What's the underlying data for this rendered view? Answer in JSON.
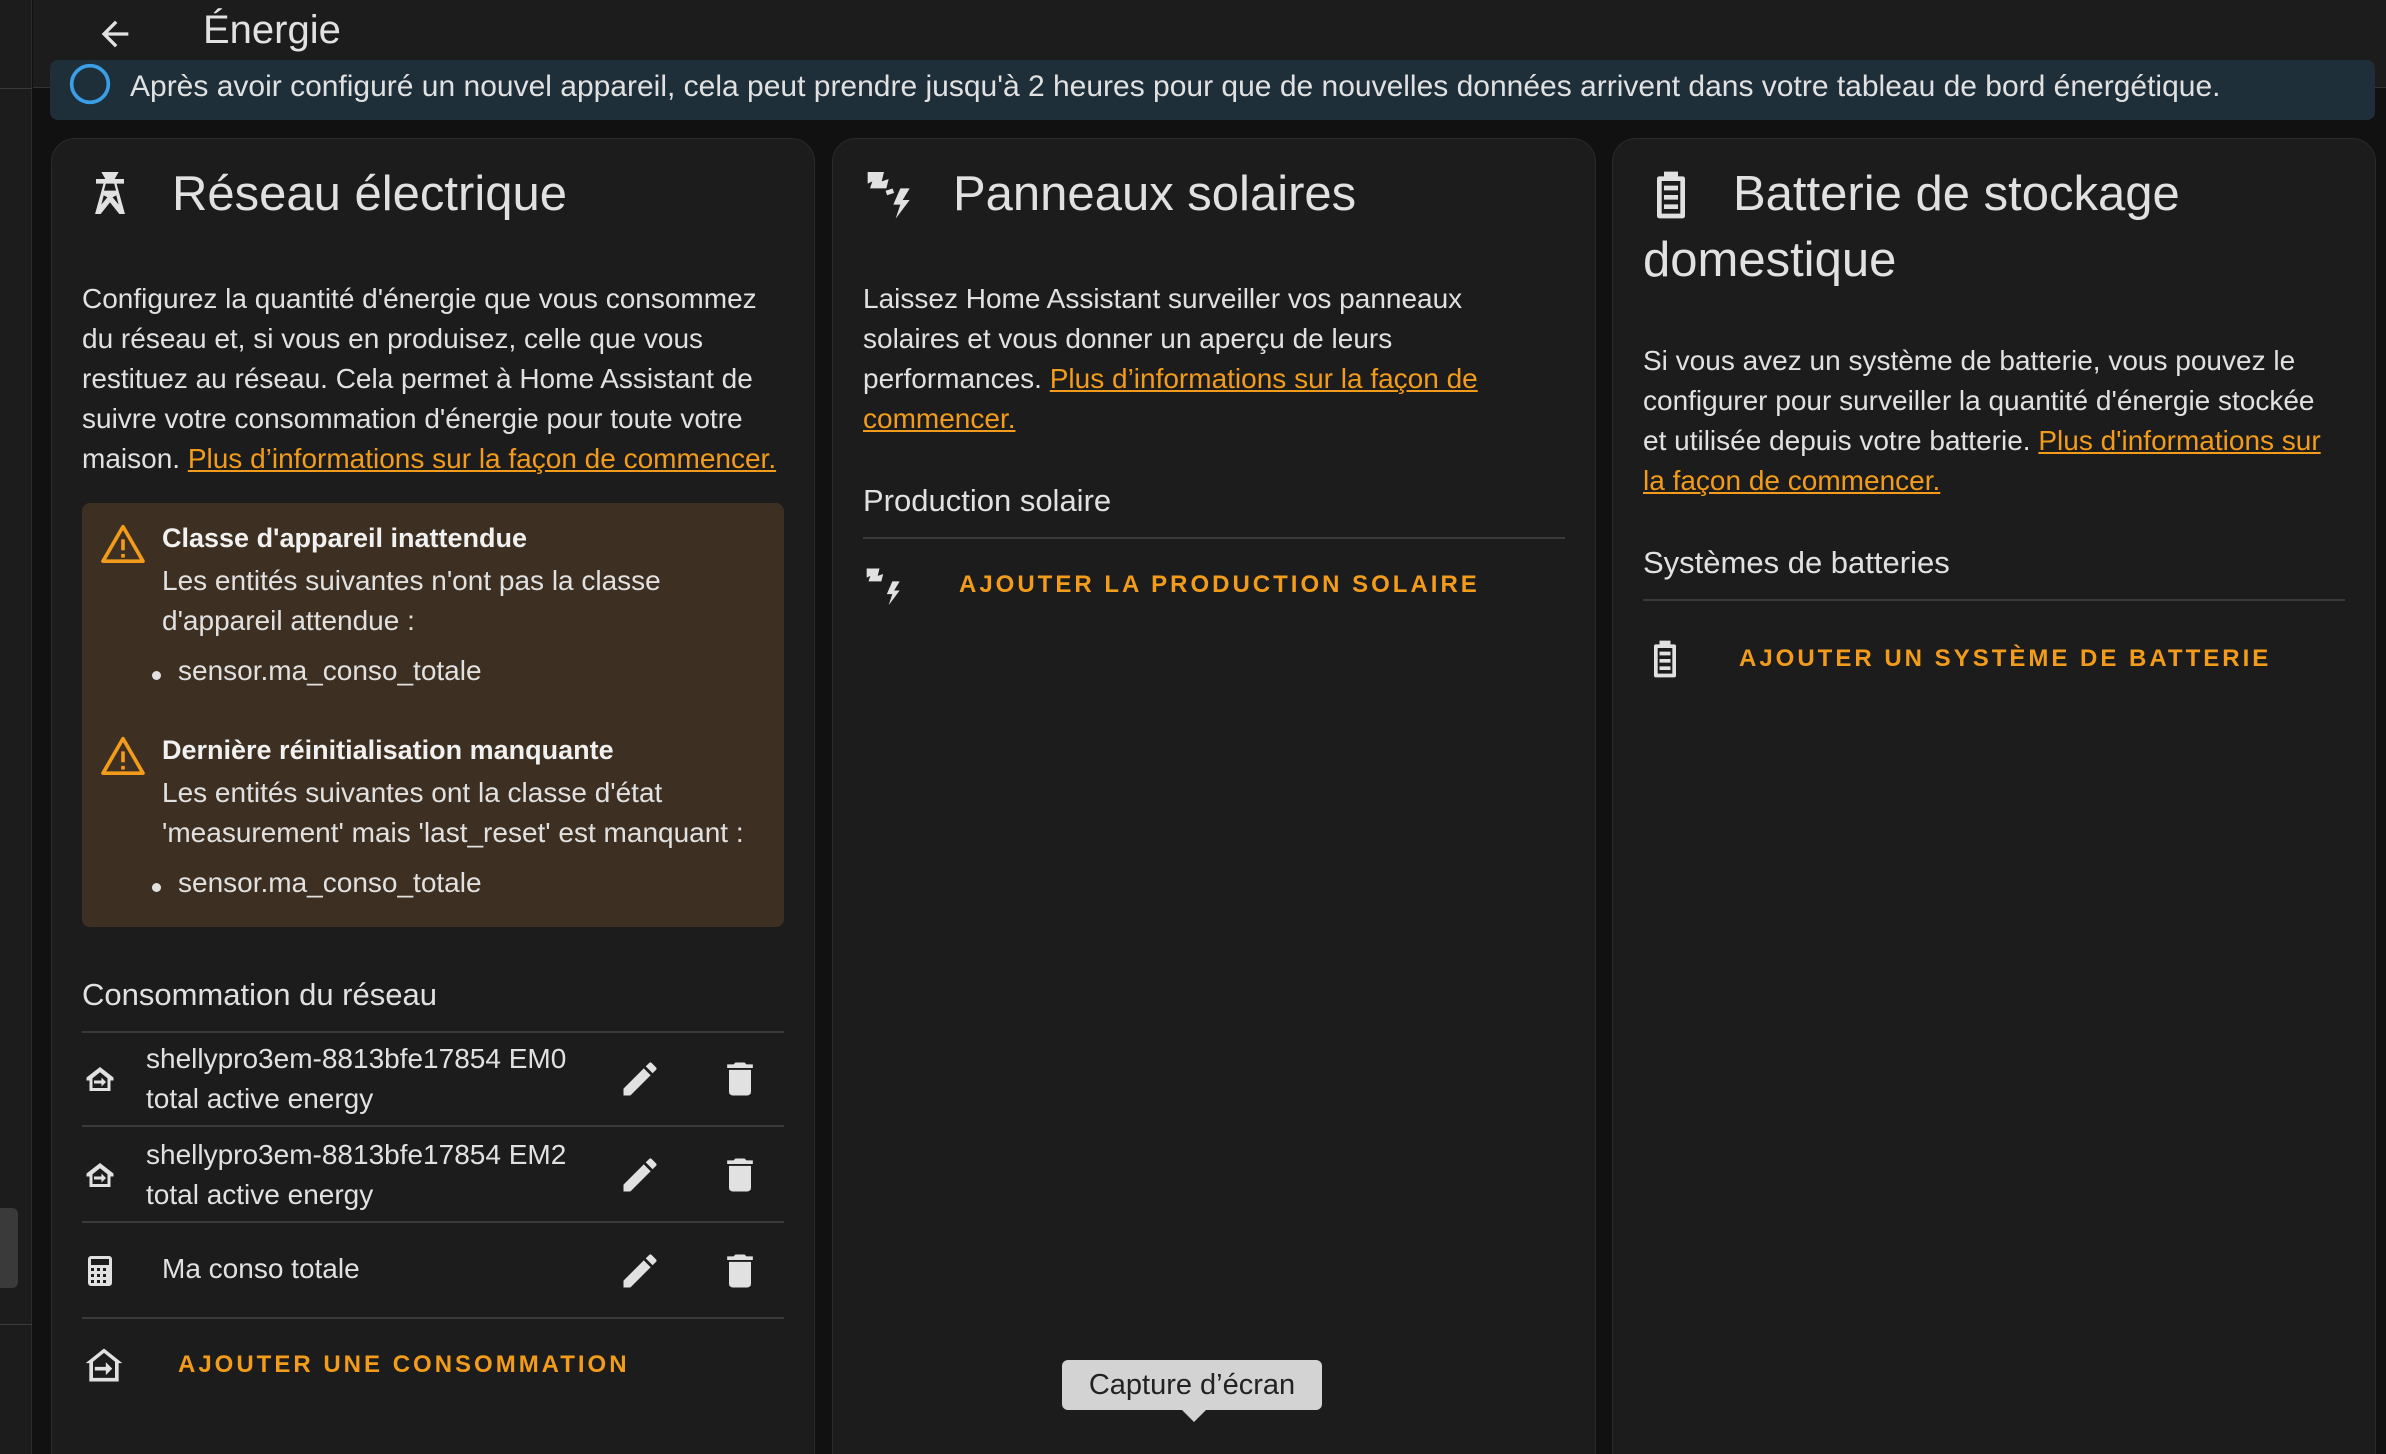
{
  "header": {
    "title": "Énergie"
  },
  "banner": {
    "text": "Après avoir configuré un nouvel appareil, cela peut prendre jusqu'à 2 heures pour que de nouvelles données arrivent dans votre tableau de bord énergétique."
  },
  "grid": {
    "title": "Réseau électrique",
    "description": "Configurez la quantité d'énergie que vous consommez du réseau et, si vous en produisez, celle que vous restituez au réseau. Cela permet à Home Assistant de suivre votre consommation d'énergie pour toute votre maison.",
    "link": "Plus d’informations sur la façon de commencer.",
    "alerts": [
      {
        "title": "Classe d'appareil inattendue",
        "body": "Les entités suivantes n'ont pas la classe d'appareil attendue :",
        "item": "sensor.ma_conso_totale"
      },
      {
        "title": "Dernière réinitialisation manquante",
        "body": "Les entités suivantes ont la classe d'état 'measurement' mais 'last_reset' est manquant :",
        "item": "sensor.ma_conso_totale"
      }
    ],
    "consumption_title": "Consommation du réseau",
    "rows": [
      {
        "line1": "shellypro3em-8813bfe17854 EM0",
        "line2": "total active energy"
      },
      {
        "line1": "shellypro3em-8813bfe17854 EM2",
        "line2": "total active energy"
      },
      {
        "line1": "Ma conso totale"
      }
    ],
    "add_label": "AJOUTER UNE CONSOMMATION"
  },
  "solar": {
    "title": "Panneaux solaires",
    "description": "Laissez Home Assistant surveiller vos panneaux solaires et vous donner un aperçu de leurs performances.",
    "link": "Plus d’informations sur la façon de commencer.",
    "section_title": "Production solaire",
    "add_label": "AJOUTER LA PRODUCTION SOLAIRE"
  },
  "battery": {
    "title": "Batterie de stockage domestique",
    "description": "Si vous avez un système de batterie, vous pouvez le configurer pour surveiller la quantité d'énergie stockée et utilisée depuis votre batterie.",
    "link": "Plus d'informations sur la façon de commencer.",
    "section_title": "Systèmes de batteries",
    "add_label": "AJOUTER UN SYSTÈME DE BATTERIE"
  },
  "tooltip": {
    "text": "Capture d’écran"
  },
  "colors": {
    "accent": "#f39c1b",
    "card": "#1c1c1c",
    "warning_bg": "#3d3022",
    "info_bg": "#1f2f3a"
  }
}
